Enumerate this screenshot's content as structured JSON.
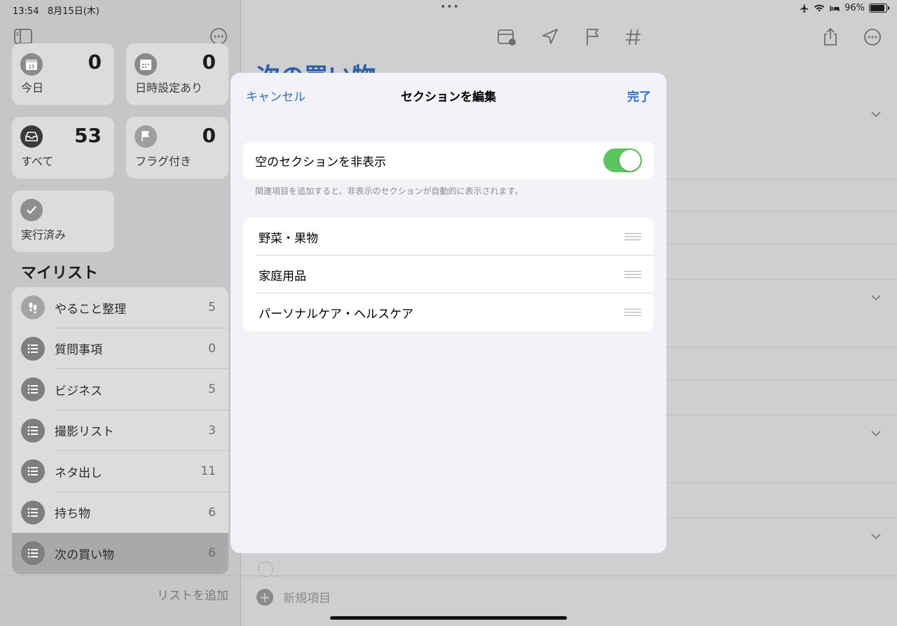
{
  "status": {
    "time": "13:54",
    "date": "8月15日(木)",
    "battery": "96%",
    "battery_level": 0.96
  },
  "sidebar": {
    "cards": [
      {
        "label": "今日",
        "count": "0",
        "icon": "calendar-today-icon"
      },
      {
        "label": "日時設定あり",
        "count": "0",
        "icon": "calendar-scheduled-icon"
      },
      {
        "label": "すべて",
        "count": "53",
        "icon": "tray-icon"
      },
      {
        "label": "フラグ付き",
        "count": "0",
        "icon": "flag-icon"
      },
      {
        "label": "実行済み",
        "count": "",
        "icon": "checkmark-icon"
      }
    ],
    "today_icon_day": "15",
    "mylists_title": "マイリスト",
    "lists": [
      {
        "name": "やること整理",
        "count": "5"
      },
      {
        "name": "質問事項",
        "count": "0"
      },
      {
        "name": "ビジネス",
        "count": "5"
      },
      {
        "name": "撮影リスト",
        "count": "3"
      },
      {
        "name": "ネタ出し",
        "count": "11"
      },
      {
        "name": "持ち物",
        "count": "6"
      },
      {
        "name": "次の買い物",
        "count": "6"
      }
    ],
    "add_list": "リストを追加"
  },
  "main": {
    "title": "次の買い物",
    "new_item": "新規項目"
  },
  "modal": {
    "cancel": "キャンセル",
    "title": "セクションを編集",
    "done": "完了",
    "toggle_label": "空のセクションを非表示",
    "toggle_on": true,
    "footnote": "関連項目を追加すると、非表示のセクションが自動的に表示されます。",
    "sections": [
      "野菜・果物",
      "家庭用品",
      "パーソナルケア・ヘルスケア"
    ]
  },
  "colors": {
    "accent": "#2f6fc6",
    "toggle_on": "#5bc65f"
  }
}
